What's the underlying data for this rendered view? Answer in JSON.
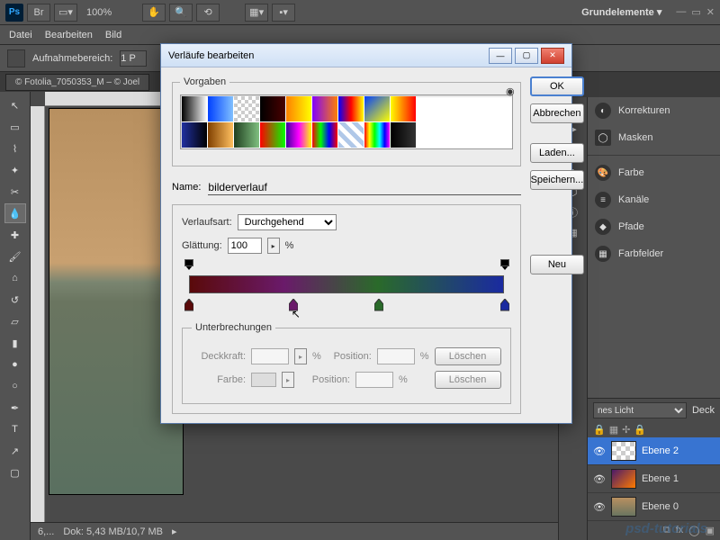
{
  "app": {
    "zoom": "100%",
    "workspace": "Grundelemente ▾"
  },
  "menu": [
    "Datei",
    "Bearbeiten",
    "Bild"
  ],
  "options": {
    "label": "Aufnahmebereich:",
    "value": "1 P"
  },
  "doc_tab": "© Fotolia_7050353_M – © Joel",
  "status": {
    "zoom": "6,...",
    "doc": "Dok: 5,43 MB/10,7 MB"
  },
  "right_panels": {
    "top": [
      "Korrekturen",
      "Masken"
    ],
    "mid": [
      "Farbe",
      "Kanäle",
      "Pfade",
      "Farbfelder"
    ]
  },
  "layers": {
    "blend_mode": "nes Licht",
    "opacity_label": "Deck",
    "items": [
      {
        "name": "Ebene 2",
        "selected": true,
        "thumb": "check"
      },
      {
        "name": "Ebene 1",
        "selected": false,
        "thumb": "grad"
      },
      {
        "name": "Ebene 0",
        "selected": false,
        "thumb": "photo"
      }
    ]
  },
  "dialog": {
    "title": "Verläufe bearbeiten",
    "presets_label": "Vorgaben",
    "buttons": {
      "ok": "OK",
      "cancel": "Abbrechen",
      "load": "Laden...",
      "save": "Speichern...",
      "new": "Neu"
    },
    "name_label": "Name:",
    "name_value": "bilderverlauf",
    "type_label": "Verlaufsart:",
    "type_value": "Durchgehend",
    "smooth_label": "Glättung:",
    "smooth_value": "100",
    "breaks": {
      "legend": "Unterbrechungen",
      "opacity_label": "Deckkraft:",
      "color_label": "Farbe:",
      "position_label": "Position:",
      "delete": "Löschen"
    },
    "preset_colors": [
      "linear-gradient(90deg,#000,#fff)",
      "linear-gradient(90deg,#0040ff,#80c0ff)",
      "repeating-conic-gradient(#fff 0 25%,#ccc 0 50%) 0 0/8px 8px",
      "linear-gradient(90deg,#000,#4a0000)",
      "linear-gradient(90deg,#ff8000,#ffff00)",
      "linear-gradient(90deg,#8000ff,#ff8000)",
      "linear-gradient(90deg,#0000ff,#ff0000,#ffff00)",
      "linear-gradient(135deg,#0040ff,#ffff00)",
      "linear-gradient(90deg,#ffff00,#ff0000)",
      "linear-gradient(90deg,#2030a0,#000)",
      "linear-gradient(90deg,#804000,#ffc060)",
      "linear-gradient(90deg,#204020,#80c080)",
      "linear-gradient(90deg,#ff0000,#00ff00)",
      "linear-gradient(90deg,#4000a0,#ff00ff,#ffff00)",
      "linear-gradient(90deg,#ff0000,#00ff00,#0000ff,#ff0000)",
      "repeating-linear-gradient(45deg,#b0c8e8 0 5px,#fff 5px 10px)",
      "linear-gradient(90deg,#ff0000,#ffff00,#00ff00,#00ffff,#0000ff,#ff00ff)",
      "linear-gradient(90deg,#000,#333)"
    ],
    "top_stops": [
      0,
      100
    ],
    "bottom_stops": [
      {
        "pos": 0,
        "color": "#5a0a0a"
      },
      {
        "pos": 33,
        "color": "#6a1a6a"
      },
      {
        "pos": 60,
        "color": "#2a6a2a"
      },
      {
        "pos": 100,
        "color": "#1a2aa0"
      }
    ],
    "cursor_at": 33
  },
  "watermark": "psd-tutorials"
}
